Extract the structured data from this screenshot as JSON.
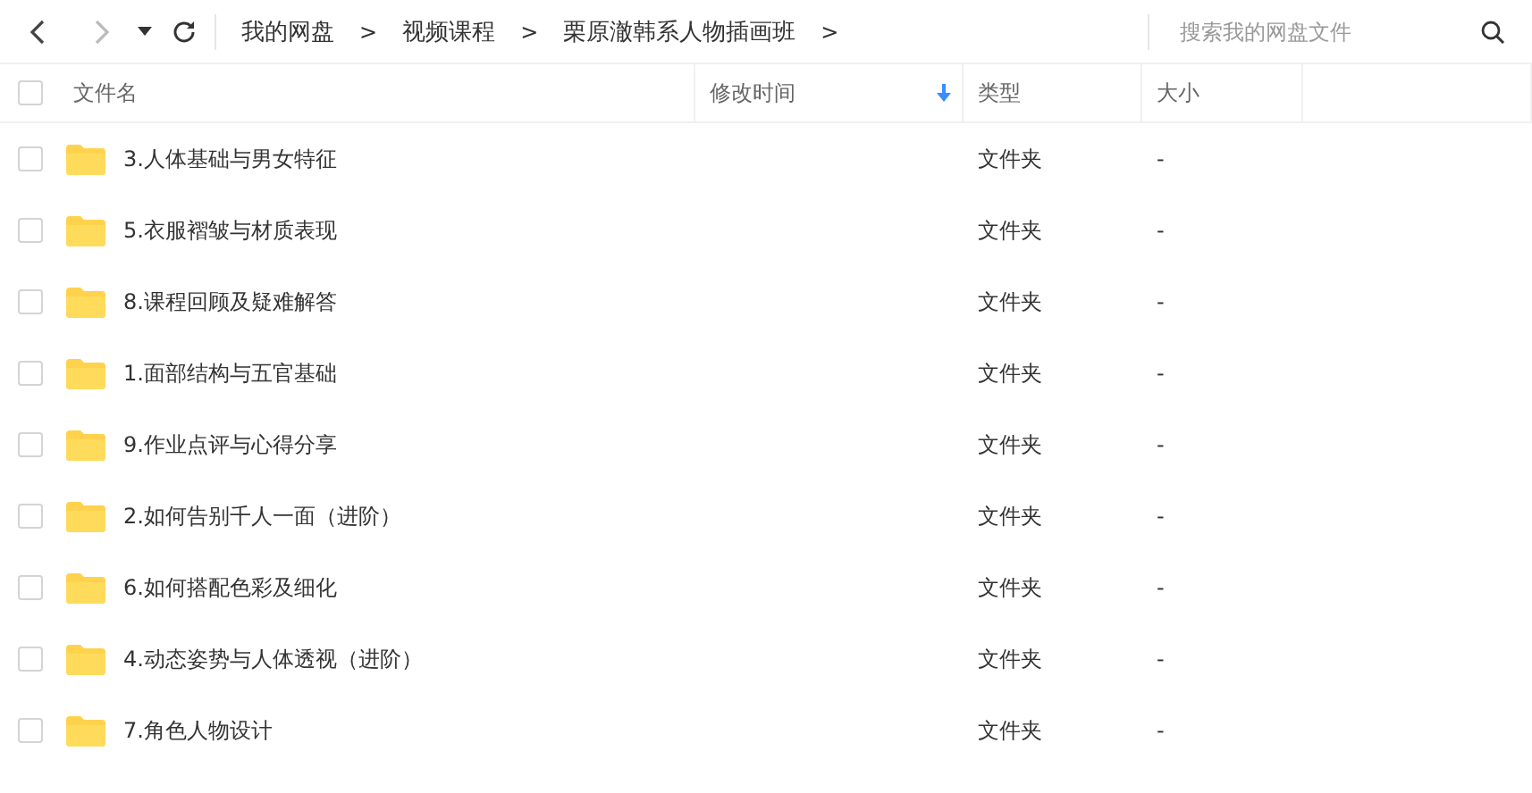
{
  "toolbar": {
    "back": {
      "disabled": false
    },
    "forward": {
      "disabled": true
    },
    "breadcrumb": [
      {
        "label": "我的网盘"
      },
      {
        "label": "视频课程"
      },
      {
        "label": "栗原澈韩系人物插画班"
      }
    ],
    "separator": ">",
    "search": {
      "placeholder": "搜索我的网盘文件"
    }
  },
  "table": {
    "select_all": {
      "checked": false
    },
    "columns": [
      {
        "label": "文件名",
        "sorted": false
      },
      {
        "label": "修改时间",
        "sorted": true
      },
      {
        "label": "类型",
        "sorted": false
      },
      {
        "label": "大小",
        "sorted": false
      }
    ],
    "rows": [
      {
        "name": "3.人体基础与男女特征",
        "type": "文件夹",
        "size": "-",
        "checked": false
      },
      {
        "name": "5.衣服褶皱与材质表现",
        "type": "文件夹",
        "size": "-",
        "checked": false
      },
      {
        "name": "8.课程回顾及疑难解答",
        "type": "文件夹",
        "size": "-",
        "checked": false
      },
      {
        "name": "1.面部结构与五官基础",
        "type": "文件夹",
        "size": "-",
        "checked": false
      },
      {
        "name": "9.作业点评与心得分享",
        "type": "文件夹",
        "size": "-",
        "checked": false
      },
      {
        "name": "2.如何告别千人一面（进阶）",
        "type": "文件夹",
        "size": "-",
        "checked": false
      },
      {
        "name": "6.如何搭配色彩及细化",
        "type": "文件夹",
        "size": "-",
        "checked": false
      },
      {
        "name": "4.动态姿势与人体透视（进阶）",
        "type": "文件夹",
        "size": "-",
        "checked": false
      },
      {
        "name": "7.角色人物设计",
        "type": "文件夹",
        "size": "-",
        "checked": false
      }
    ]
  }
}
